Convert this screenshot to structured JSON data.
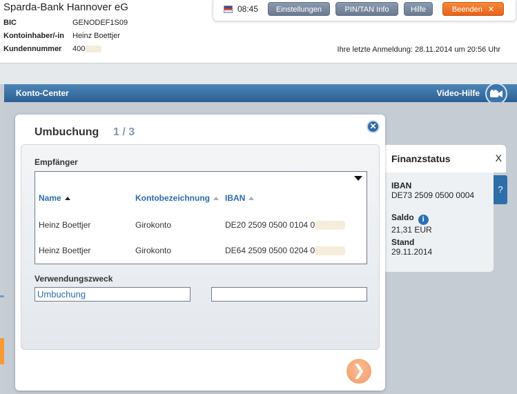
{
  "header": {
    "bank_name": "Sparda-Bank Hannover eG",
    "bic_label": "BIC",
    "bic_value": "GENODEF1S09",
    "owner_label": "Kontoinhaber/-in",
    "owner_value": "Heinz Boettjer",
    "customer_no_label": "Kundennummer",
    "customer_no_value": "400",
    "last_login": "Ihre letzte Anmeldung: 28.11.2014 um 20:56 Uhr",
    "clock": "08:45",
    "buttons": {
      "settings": "Einstellungen",
      "pintan": "PIN/TAN Info",
      "help": "Hilfe",
      "logout": "Beenden",
      "logout_icon": "✕"
    }
  },
  "konto_center": {
    "title": "Konto-Center",
    "video_help": "Video-Hilfe"
  },
  "dialog": {
    "title": "Umbuchung",
    "step": "1 / 3",
    "close_icon": "✕",
    "recipient_label": "Empfänger",
    "columns": [
      "Name",
      "Kontobezeichnung",
      "IBAN"
    ],
    "rows": [
      {
        "name": "Heinz Boettjer",
        "account": "Girokonto",
        "iban": "DE20 2509 0500 0104 0"
      },
      {
        "name": "Heinz Boettjer",
        "account": "Girokonto",
        "iban": "DE64 2509 0500 0204 0"
      }
    ],
    "purpose_label": "Verwendungszweck",
    "purpose_value": "Umbuchung",
    "purpose_value_2": "",
    "next_icon": "❯"
  },
  "finanzstatus": {
    "title": "Finanzstatus",
    "close": "X",
    "iban_label": "IBAN",
    "iban_value": "DE73 2509 0500 0004",
    "saldo_label": "Saldo",
    "saldo_value": "21,31 EUR",
    "stand_label": "Stand",
    "stand_value": "29.11.2014",
    "info_icon": "i",
    "help_tab": "?"
  }
}
